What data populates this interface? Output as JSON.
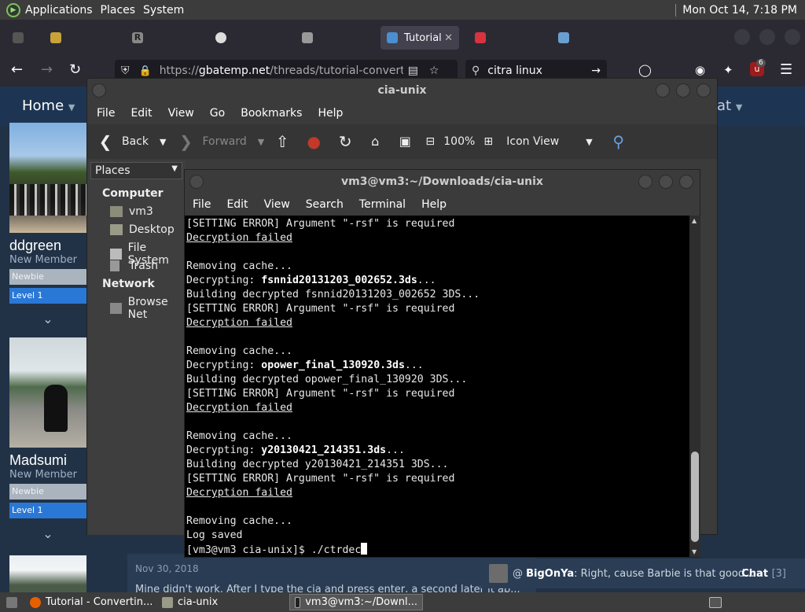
{
  "panel": {
    "applications": "Applications",
    "places": "Places",
    "system": "System",
    "clock": "Mon Oct 14,  7:18 PM"
  },
  "browser": {
    "tabs": [
      {
        "label": "",
        "favicon": "folder-icon"
      },
      {
        "label": "",
        "favicon": "r-icon"
      },
      {
        "label": "",
        "favicon": "github-icon"
      },
      {
        "label": "",
        "favicon": "ferret-icon"
      },
      {
        "label": "Tutorial",
        "favicon": "gbatemp-icon",
        "active": true
      },
      {
        "label": "",
        "favicon": "gmail-icon"
      },
      {
        "label": "",
        "favicon": "app-icon"
      }
    ],
    "url_host": "gbatemp.net",
    "url_prefix": "https://",
    "url_path": "/threads/tutorial-converting-/",
    "search_value": "citra linux",
    "notif_count": "6"
  },
  "site": {
    "home": "Home",
    "chat_hint": "at",
    "users": [
      {
        "name": "ddgreen",
        "title": "New Member",
        "badge": "Newbie",
        "level": "Level 1"
      },
      {
        "name": "Madsumi",
        "title": "New Member",
        "badge": "Newbie",
        "level": "Level 1"
      }
    ],
    "post_date": "Nov 30, 2018",
    "post_text": "Mine didn't work. After I type the cia and press enter, a second later it ap...",
    "chat": {
      "prefix": "@",
      "user": "BigOnYa",
      "message": ": Right, cause Barbie is that good...",
      "label": "Chat",
      "count": "[3]"
    }
  },
  "nautilus": {
    "title": "cia-unix",
    "menu": [
      "File",
      "Edit",
      "View",
      "Go",
      "Bookmarks",
      "Help"
    ],
    "toolbar": {
      "back": "Back",
      "forward": "Forward",
      "zoom": "100%",
      "view_mode": "Icon View"
    },
    "sidebar": {
      "places": "Places",
      "computer": "Computer",
      "computer_items": [
        "vm3",
        "Desktop",
        "File System",
        "Trash"
      ],
      "network": "Network",
      "network_items": [
        "Browse Net"
      ]
    }
  },
  "terminal": {
    "title": "vm3@vm3:~/Downloads/cia-unix",
    "menu": [
      "File",
      "Edit",
      "View",
      "Search",
      "Terminal",
      "Help"
    ],
    "lines": [
      {
        "pre": "[SETTING ERROR] Argument \"-rsf\" is required",
        "bold": "",
        "post": "",
        "u": false
      },
      {
        "pre": "Decryption failed",
        "bold": "",
        "post": "",
        "u": true
      },
      {
        "pre": "",
        "bold": "",
        "post": "",
        "u": false
      },
      {
        "pre": "Removing cache...",
        "bold": "",
        "post": "",
        "u": false
      },
      {
        "pre": "Decrypting: ",
        "bold": "fsnnid20131203_002652.3ds",
        "post": "...",
        "u": false
      },
      {
        "pre": "Building decrypted fsnnid20131203_002652 3DS...",
        "bold": "",
        "post": "",
        "u": false
      },
      {
        "pre": "[SETTING ERROR] Argument \"-rsf\" is required",
        "bold": "",
        "post": "",
        "u": false
      },
      {
        "pre": "Decryption failed",
        "bold": "",
        "post": "",
        "u": true
      },
      {
        "pre": "",
        "bold": "",
        "post": "",
        "u": false
      },
      {
        "pre": "Removing cache...",
        "bold": "",
        "post": "",
        "u": false
      },
      {
        "pre": "Decrypting: ",
        "bold": "opower_final_130920.3ds",
        "post": "...",
        "u": false
      },
      {
        "pre": "Building decrypted opower_final_130920 3DS...",
        "bold": "",
        "post": "",
        "u": false
      },
      {
        "pre": "[SETTING ERROR] Argument \"-rsf\" is required",
        "bold": "",
        "post": "",
        "u": false
      },
      {
        "pre": "Decryption failed",
        "bold": "",
        "post": "",
        "u": true
      },
      {
        "pre": "",
        "bold": "",
        "post": "",
        "u": false
      },
      {
        "pre": "Removing cache...",
        "bold": "",
        "post": "",
        "u": false
      },
      {
        "pre": "Decrypting: ",
        "bold": "y20130421_214351.3ds",
        "post": "...",
        "u": false
      },
      {
        "pre": "Building decrypted y20130421_214351 3DS...",
        "bold": "",
        "post": "",
        "u": false
      },
      {
        "pre": "[SETTING ERROR] Argument \"-rsf\" is required",
        "bold": "",
        "post": "",
        "u": false
      },
      {
        "pre": "Decryption failed",
        "bold": "",
        "post": "",
        "u": true
      },
      {
        "pre": "",
        "bold": "",
        "post": "",
        "u": false
      },
      {
        "pre": "Removing cache...",
        "bold": "",
        "post": "",
        "u": false
      },
      {
        "pre": "Log saved",
        "bold": "",
        "post": "",
        "u": false
      }
    ],
    "prompt": "[vm3@vm3 cia-unix]$ ",
    "command": "./ctrdec"
  },
  "taskbar": {
    "items": [
      {
        "label": "Tutorial - Convertin...",
        "icon": "firefox-icon"
      },
      {
        "label": "cia-unix",
        "icon": "folder-icon"
      },
      {
        "label": "vm3@vm3:~/Downl...",
        "icon": "terminal-icon"
      }
    ]
  }
}
